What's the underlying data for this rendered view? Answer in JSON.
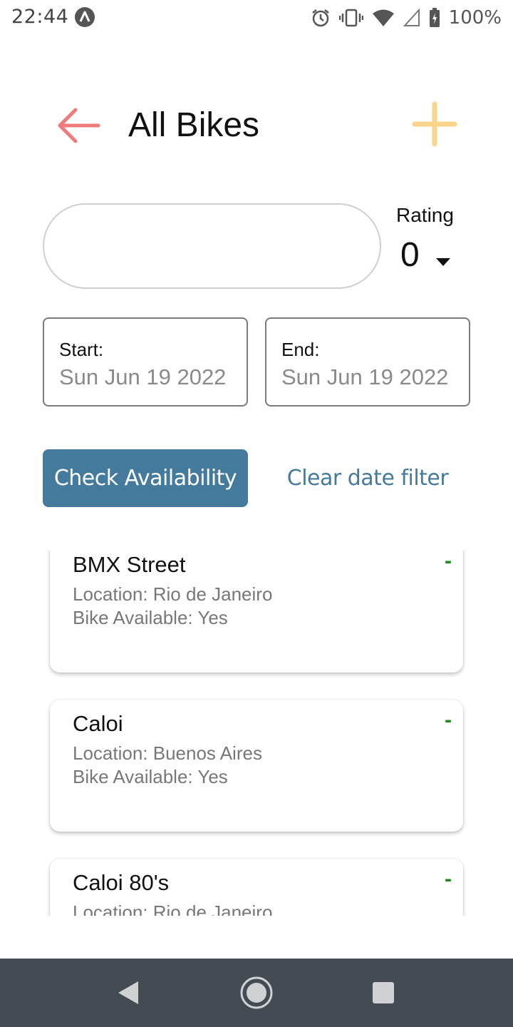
{
  "status_bar": {
    "time": "22:44",
    "battery": "100%",
    "icons": [
      "app-a-icon",
      "alarm-icon",
      "vibrate-icon",
      "wifi-icon",
      "signal-icon",
      "battery-charging-icon"
    ]
  },
  "header": {
    "title": "All Bikes",
    "back_icon": "arrow-left-icon",
    "add_icon": "plus-icon"
  },
  "search": {
    "value": "",
    "placeholder": ""
  },
  "rating": {
    "label": "Rating",
    "value": "0"
  },
  "dates": {
    "start_label": "Start:",
    "start_value": "Sun Jun 19 2022",
    "end_label": "End:",
    "end_value": "Sun Jun 19 2022"
  },
  "actions": {
    "check_label": "Check Availability",
    "clear_label": "Clear date filter"
  },
  "bikes": [
    {
      "name": "BMX Street",
      "location": "Location: Rio de Janeiro",
      "available": "Bike Available: Yes",
      "rating_mark": "-"
    },
    {
      "name": "Caloi",
      "location": "Location: Buenos Aires",
      "available": "Bike Available: Yes",
      "rating_mark": "-"
    },
    {
      "name": "Caloi 80's",
      "location": "Location: Rio de Janeiro",
      "available": "",
      "rating_mark": "-"
    }
  ],
  "nav": {
    "icons": [
      "back-triangle-icon",
      "home-circle-icon",
      "recents-square-icon"
    ]
  },
  "colors": {
    "back_arrow": "#ef7b7b",
    "add_plus": "#f9d48a",
    "primary": "#447a9c",
    "dash_green": "#1f8a1f",
    "nav_bar": "#454b52"
  }
}
